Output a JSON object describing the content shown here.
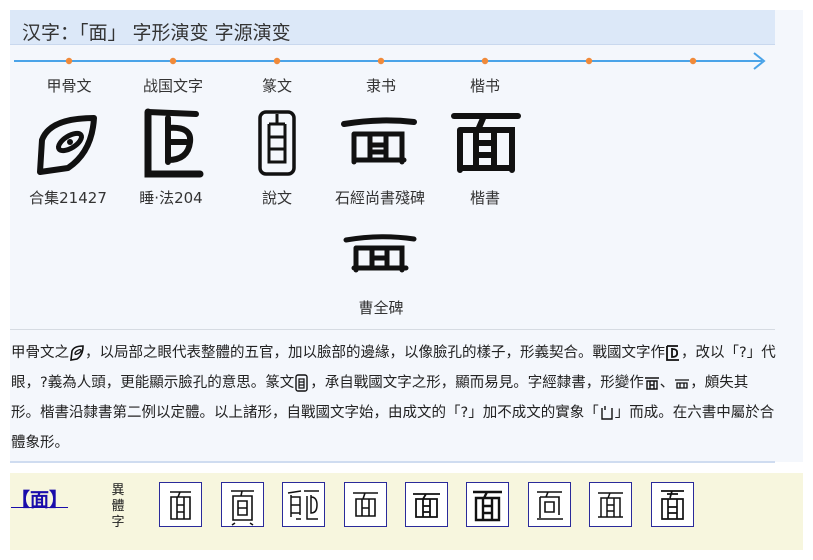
{
  "title": "汉字：「面」 字形演变 字源演变",
  "stages": [
    "甲骨文",
    "战国文字",
    "篆文",
    "隶书",
    "楷书"
  ],
  "glyph_captions": [
    "合集21427",
    "睡·法204",
    "說文",
    "石經尚書殘碑",
    "楷書",
    "曹全碑"
  ],
  "description": {
    "p1": "甲骨文之",
    "p2": "，以局部之眼代表整體的五官，加以臉部的邊緣，以像臉孔的樣子，形義契合。戰國文字作",
    "p3": "，改以「?」代眼，?義為人頭，更能顯示臉孔的意思。篆文",
    "p4": "，承自戰國文字之形，顯而易見。字經隸書，形變作",
    "p5": "、",
    "p6": "，頗失其形。楷書沿隸書第二例以定體。以上諸形，自戰國文字始，由成文的「?」加不成文的實象「",
    "p7": "」而成。在六書中屬於合體象形。"
  },
  "variants": {
    "char_link": "【面】",
    "label": "異體字"
  },
  "colors": {
    "title_bar": "#dce8f8",
    "timeline": "#4aa3e8",
    "timeline_dot": "#f08a3a",
    "link": "#1a0dab",
    "variant_bg": "#f7f6de"
  }
}
